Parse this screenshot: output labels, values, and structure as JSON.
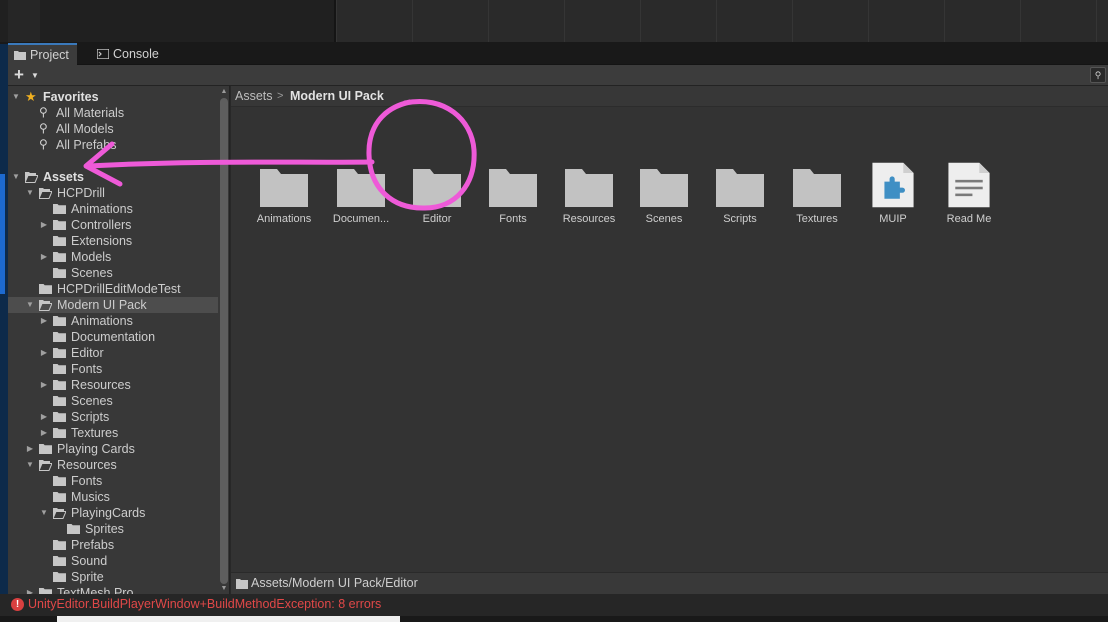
{
  "tabs": [
    {
      "label": "Project",
      "icon": "folder-icon",
      "active": true
    },
    {
      "label": "Console",
      "icon": "console-icon",
      "active": false
    }
  ],
  "toolbar": {
    "create_label": "+",
    "search_icon": "search-icon"
  },
  "tree": {
    "favorites": {
      "label": "Favorites",
      "icon": "star-icon"
    },
    "fav_items": [
      "All Materials",
      "All Models",
      "All Prefabs"
    ],
    "assets_label": "Assets",
    "items": [
      {
        "label": "HCPDrill",
        "depth": 1,
        "expander": "open",
        "folder": "open"
      },
      {
        "label": "Animations",
        "depth": 2,
        "expander": "none",
        "folder": "closed"
      },
      {
        "label": "Controllers",
        "depth": 2,
        "expander": "closed",
        "folder": "closed"
      },
      {
        "label": "Extensions",
        "depth": 2,
        "expander": "none",
        "folder": "closed"
      },
      {
        "label": "Models",
        "depth": 2,
        "expander": "closed",
        "folder": "closed"
      },
      {
        "label": "Scenes",
        "depth": 2,
        "expander": "none",
        "folder": "closed"
      },
      {
        "label": "HCPDrillEditModeTest",
        "depth": 1,
        "expander": "none",
        "folder": "closed"
      },
      {
        "label": "Modern UI Pack",
        "depth": 1,
        "expander": "open",
        "folder": "open",
        "selected": true
      },
      {
        "label": "Animations",
        "depth": 2,
        "expander": "closed",
        "folder": "closed"
      },
      {
        "label": "Documentation",
        "depth": 2,
        "expander": "none",
        "folder": "closed"
      },
      {
        "label": "Editor",
        "depth": 2,
        "expander": "closed",
        "folder": "closed"
      },
      {
        "label": "Fonts",
        "depth": 2,
        "expander": "none",
        "folder": "closed"
      },
      {
        "label": "Resources",
        "depth": 2,
        "expander": "closed",
        "folder": "closed"
      },
      {
        "label": "Scenes",
        "depth": 2,
        "expander": "none",
        "folder": "closed"
      },
      {
        "label": "Scripts",
        "depth": 2,
        "expander": "closed",
        "folder": "closed"
      },
      {
        "label": "Textures",
        "depth": 2,
        "expander": "closed",
        "folder": "closed"
      },
      {
        "label": "Playing Cards",
        "depth": 1,
        "expander": "closed",
        "folder": "closed"
      },
      {
        "label": "Resources",
        "depth": 1,
        "expander": "open",
        "folder": "open"
      },
      {
        "label": "Fonts",
        "depth": 2,
        "expander": "none",
        "folder": "closed"
      },
      {
        "label": "Musics",
        "depth": 2,
        "expander": "none",
        "folder": "closed"
      },
      {
        "label": "PlayingCards",
        "depth": 2,
        "expander": "open",
        "folder": "open"
      },
      {
        "label": "Sprites",
        "depth": 3,
        "expander": "none",
        "folder": "closed"
      },
      {
        "label": "Prefabs",
        "depth": 2,
        "expander": "none",
        "folder": "closed"
      },
      {
        "label": "Sound",
        "depth": 2,
        "expander": "none",
        "folder": "closed"
      },
      {
        "label": "Sprite",
        "depth": 2,
        "expander": "none",
        "folder": "closed"
      },
      {
        "label": "TextMesh Pro",
        "depth": 1,
        "expander": "closed",
        "folder": "closed"
      }
    ]
  },
  "breadcrumb": {
    "root": "Assets",
    "current": "Modern UI Pack"
  },
  "grid": [
    {
      "label": "Animations",
      "kind": "folder"
    },
    {
      "label": "Documen...",
      "kind": "folder"
    },
    {
      "label": "Editor",
      "kind": "folder"
    },
    {
      "label": "Fonts",
      "kind": "folder"
    },
    {
      "label": "Resources",
      "kind": "folder"
    },
    {
      "label": "Scenes",
      "kind": "folder"
    },
    {
      "label": "Scripts",
      "kind": "folder"
    },
    {
      "label": "Textures",
      "kind": "folder"
    },
    {
      "label": "MUIP",
      "kind": "puzzle-asset"
    },
    {
      "label": "Read Me",
      "kind": "document"
    }
  ],
  "status_path": "Assets/Modern UI Pack/Editor",
  "error": {
    "icon": "error-icon",
    "text": "UnityEditor.BuildPlayerWindow+BuildMethodException: 8 errors"
  },
  "colors": {
    "accent_tab": "#3a79bb",
    "error": "#e04848",
    "annotation": "#ee5ad8"
  }
}
